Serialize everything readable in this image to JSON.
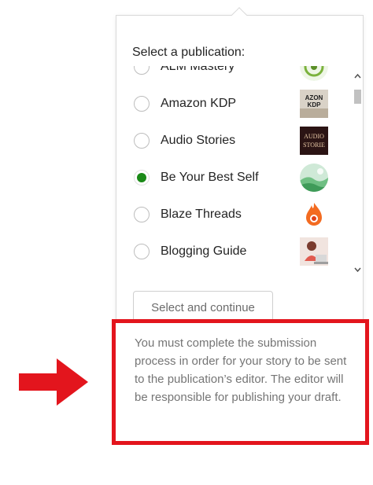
{
  "popover": {
    "heading": "Select a publication:",
    "items": [
      {
        "label": "ALM Mastery",
        "selected": false,
        "thumbnail": "alm-mastery-logo"
      },
      {
        "label": "Amazon KDP",
        "selected": false,
        "thumbnail": "amazon-kdp-logo",
        "thumb_text": "AZON KDP"
      },
      {
        "label": "Audio Stories",
        "selected": false,
        "thumbnail": "audio-stories-logo",
        "thumb_text": "AUDIO STORIE"
      },
      {
        "label": "Be Your Best Self",
        "selected": true,
        "thumbnail": "be-your-best-self-logo"
      },
      {
        "label": "Blaze Threads",
        "selected": false,
        "thumbnail": "blaze-threads-logo"
      },
      {
        "label": "Blogging Guide",
        "selected": false,
        "thumbnail": "blogging-guide-logo"
      }
    ],
    "continue_label": "Select and continue"
  },
  "note": {
    "text": "You must complete the submission process in order for your story to be sent to the publication’s editor. The editor will be responsible for publishing your draft."
  },
  "colors": {
    "accent_green": "#1a8917",
    "highlight_red": "#e3151d",
    "muted_text": "#757575"
  }
}
